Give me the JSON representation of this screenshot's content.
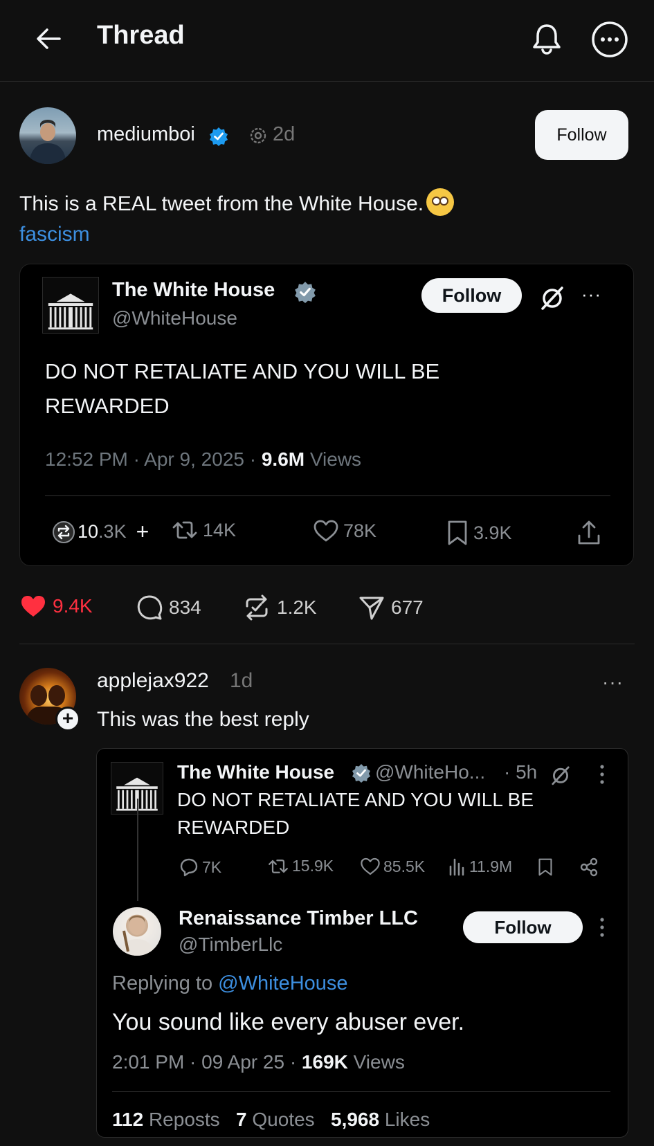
{
  "header": {
    "title": "Thread"
  },
  "post": {
    "username": "mediumboi",
    "time": "2d",
    "follow_label": "Follow",
    "text": "This is a REAL tweet from the White House.",
    "tag": "fascism"
  },
  "embed": {
    "name": "The White House",
    "handle": "@WhiteHouse",
    "follow_label": "Follow",
    "more": "···",
    "body": "DO NOT RETALIATE AND YOU WILL BE REWARDED",
    "meta_time": "12:52 PM · Apr 9, 2025 · ",
    "meta_views_count": "9.6M",
    "meta_views_label": " Views",
    "stats": {
      "quote_overlay": "10",
      "quote_value": ".3K",
      "plus": "+",
      "reposts": "14K",
      "likes": "78K",
      "bookmarks": "3.9K"
    }
  },
  "reactions": {
    "likes": "9.4K",
    "replies": "834",
    "reposts": "1.2K",
    "shares": "677"
  },
  "reply": {
    "username": "applejax922",
    "time": "1d",
    "more": "···",
    "text": "This was the best reply",
    "shot": {
      "wh_name": "The White House",
      "wh_handle": "@WhiteHo...",
      "wh_time": "· 5h",
      "wh_body": "DO NOT RETALIATE AND YOU WILL BE REWARDED",
      "stats": {
        "replies": "7K",
        "reposts": "15.9K",
        "likes": "85.5K",
        "views": "11.9M"
      },
      "timber_name": "Renaissance Timber LLC",
      "timber_handle": "@TimberLlc",
      "timber_follow": "Follow",
      "replying_prefix": "Replying to ",
      "replying_handle": "@WhiteHouse",
      "timber_text": "You sound like every abuser ever.",
      "timber_time": "2:01 PM · 09 Apr 25 · ",
      "timber_views_count": "169K",
      "timber_views_label": " Views",
      "reposts_count": "112",
      "reposts_label": " Reposts",
      "quotes_count": "7",
      "quotes_label": " Quotes",
      "likes_count": "5,968",
      "likes_label": " Likes"
    }
  },
  "colors": {
    "background": "#101010",
    "link": "#3d8fe0",
    "like": "#ff3040",
    "verified_blue": "#1d9bf0",
    "verified_gray": "#829aab"
  },
  "icons": [
    "back-arrow-icon",
    "bell-icon",
    "more-icon",
    "verified-icon",
    "threads-badge-icon",
    "grok-icon",
    "quote-icon",
    "repost-icon",
    "heart-icon",
    "bookmark-icon",
    "share-icon",
    "comment-icon",
    "send-icon",
    "views-icon",
    "link-icon"
  ]
}
